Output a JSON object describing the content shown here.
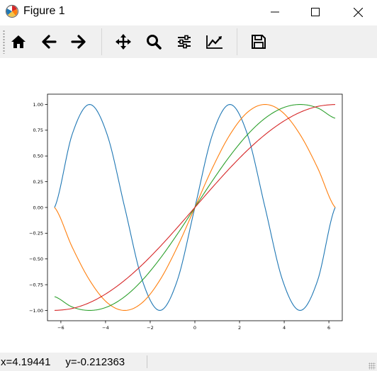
{
  "window": {
    "title": "Figure 1",
    "controls": {
      "minimize_icon": "minimize-icon",
      "maximize_icon": "maximize-icon",
      "close_icon": "close-icon"
    }
  },
  "toolbar": {
    "buttons": [
      {
        "icon": "home-icon",
        "action": "home"
      },
      {
        "icon": "back-arrow-icon",
        "action": "back"
      },
      {
        "icon": "forward-arrow-icon",
        "action": "forward"
      },
      {
        "icon": "pan-icon",
        "action": "pan"
      },
      {
        "icon": "zoom-icon",
        "action": "zoom"
      },
      {
        "icon": "subplots-icon",
        "action": "configure subplots"
      },
      {
        "icon": "axes-edit-icon",
        "action": "edit axes"
      },
      {
        "icon": "save-icon",
        "action": "save"
      }
    ]
  },
  "status": {
    "text": "x=4.19441     y=-0.212363"
  },
  "chart_data": {
    "type": "line",
    "title": "",
    "xlabel": "",
    "ylabel": "",
    "xlim": [
      -6.6,
      6.6
    ],
    "ylim": [
      -1.1,
      1.1
    ],
    "x_ticks": [
      -6,
      -4,
      -2,
      0,
      2,
      4,
      6
    ],
    "y_ticks": [
      -1.0,
      -0.75,
      -0.5,
      -0.25,
      0.0,
      0.25,
      0.5,
      0.75,
      1.0
    ],
    "x_tick_labels": [
      "−6",
      "−4",
      "−2",
      "0",
      "2",
      "4",
      "6"
    ],
    "y_tick_labels": [
      "−1.00",
      "−0.75",
      "−0.50",
      "−0.25",
      "0.00",
      "0.25",
      "0.50",
      "0.75",
      "1.00"
    ],
    "grid": false,
    "legend": "none",
    "series": [
      {
        "color": "#1f77b4",
        "x": [
          -6.283,
          -5.498,
          -4.712,
          -3.927,
          -3.142,
          -2.356,
          -1.571,
          -0.785,
          0,
          0.785,
          1.571,
          2.356,
          3.142,
          3.927,
          4.712,
          5.498,
          6.283
        ],
        "y": [
          0,
          0.707,
          1,
          0.707,
          0,
          -0.707,
          -1,
          -0.707,
          0,
          0.707,
          1,
          0.707,
          0,
          -0.707,
          -1,
          -0.707,
          0
        ]
      },
      {
        "color": "#ff7f0e",
        "x": [
          -6.283,
          -5.498,
          -4.712,
          -3.927,
          -3.142,
          -2.356,
          -1.571,
          -0.785,
          0,
          0.785,
          1.571,
          2.356,
          3.142,
          3.927,
          4.712,
          5.498,
          6.283
        ],
        "y": [
          0,
          -0.383,
          -0.707,
          -0.924,
          -1,
          -0.924,
          -0.707,
          -0.383,
          0,
          0.383,
          0.707,
          0.924,
          1,
          0.924,
          0.707,
          0.383,
          0
        ]
      },
      {
        "color": "#2ca02c",
        "x": [
          -6.283,
          -5.498,
          -4.712,
          -3.927,
          -3.142,
          -2.356,
          -1.571,
          -0.785,
          0,
          0.785,
          1.571,
          2.356,
          3.142,
          3.927,
          4.712,
          5.498,
          6.283
        ],
        "y": [
          -0.866,
          -0.966,
          -1,
          -0.966,
          -0.866,
          -0.707,
          -0.5,
          -0.259,
          0,
          0.259,
          0.5,
          0.707,
          0.866,
          0.966,
          1,
          0.966,
          0.866
        ]
      },
      {
        "color": "#d62728",
        "x": [
          -6.283,
          -5.498,
          -4.712,
          -3.927,
          -3.142,
          -2.356,
          -1.571,
          -0.785,
          0,
          0.785,
          1.571,
          2.356,
          3.142,
          3.927,
          4.712,
          5.498,
          6.283
        ],
        "y": [
          -1,
          -0.981,
          -0.924,
          -0.831,
          -0.707,
          -0.556,
          -0.383,
          -0.195,
          0,
          0.195,
          0.383,
          0.556,
          0.707,
          0.831,
          0.924,
          0.981,
          1
        ]
      }
    ]
  }
}
